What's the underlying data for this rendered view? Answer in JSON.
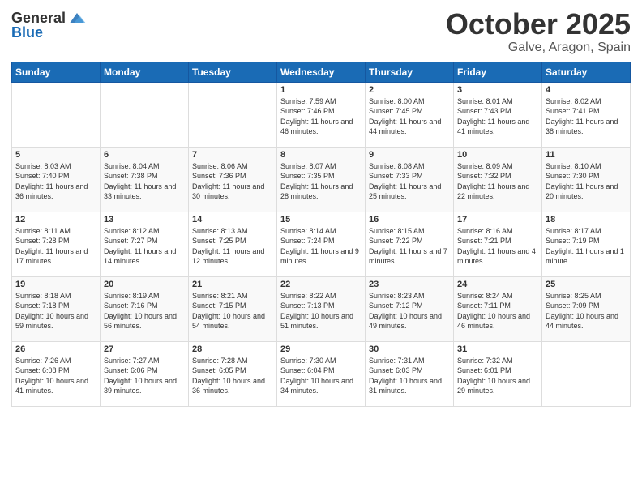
{
  "logo": {
    "general": "General",
    "blue": "Blue"
  },
  "header": {
    "month": "October 2025",
    "location": "Galve, Aragon, Spain"
  },
  "weekdays": [
    "Sunday",
    "Monday",
    "Tuesday",
    "Wednesday",
    "Thursday",
    "Friday",
    "Saturday"
  ],
  "weeks": [
    [
      {
        "day": "",
        "sunrise": "",
        "sunset": "",
        "daylight": ""
      },
      {
        "day": "",
        "sunrise": "",
        "sunset": "",
        "daylight": ""
      },
      {
        "day": "",
        "sunrise": "",
        "sunset": "",
        "daylight": ""
      },
      {
        "day": "1",
        "sunrise": "Sunrise: 7:59 AM",
        "sunset": "Sunset: 7:46 PM",
        "daylight": "Daylight: 11 hours and 46 minutes."
      },
      {
        "day": "2",
        "sunrise": "Sunrise: 8:00 AM",
        "sunset": "Sunset: 7:45 PM",
        "daylight": "Daylight: 11 hours and 44 minutes."
      },
      {
        "day": "3",
        "sunrise": "Sunrise: 8:01 AM",
        "sunset": "Sunset: 7:43 PM",
        "daylight": "Daylight: 11 hours and 41 minutes."
      },
      {
        "day": "4",
        "sunrise": "Sunrise: 8:02 AM",
        "sunset": "Sunset: 7:41 PM",
        "daylight": "Daylight: 11 hours and 38 minutes."
      }
    ],
    [
      {
        "day": "5",
        "sunrise": "Sunrise: 8:03 AM",
        "sunset": "Sunset: 7:40 PM",
        "daylight": "Daylight: 11 hours and 36 minutes."
      },
      {
        "day": "6",
        "sunrise": "Sunrise: 8:04 AM",
        "sunset": "Sunset: 7:38 PM",
        "daylight": "Daylight: 11 hours and 33 minutes."
      },
      {
        "day": "7",
        "sunrise": "Sunrise: 8:06 AM",
        "sunset": "Sunset: 7:36 PM",
        "daylight": "Daylight: 11 hours and 30 minutes."
      },
      {
        "day": "8",
        "sunrise": "Sunrise: 8:07 AM",
        "sunset": "Sunset: 7:35 PM",
        "daylight": "Daylight: 11 hours and 28 minutes."
      },
      {
        "day": "9",
        "sunrise": "Sunrise: 8:08 AM",
        "sunset": "Sunset: 7:33 PM",
        "daylight": "Daylight: 11 hours and 25 minutes."
      },
      {
        "day": "10",
        "sunrise": "Sunrise: 8:09 AM",
        "sunset": "Sunset: 7:32 PM",
        "daylight": "Daylight: 11 hours and 22 minutes."
      },
      {
        "day": "11",
        "sunrise": "Sunrise: 8:10 AM",
        "sunset": "Sunset: 7:30 PM",
        "daylight": "Daylight: 11 hours and 20 minutes."
      }
    ],
    [
      {
        "day": "12",
        "sunrise": "Sunrise: 8:11 AM",
        "sunset": "Sunset: 7:28 PM",
        "daylight": "Daylight: 11 hours and 17 minutes."
      },
      {
        "day": "13",
        "sunrise": "Sunrise: 8:12 AM",
        "sunset": "Sunset: 7:27 PM",
        "daylight": "Daylight: 11 hours and 14 minutes."
      },
      {
        "day": "14",
        "sunrise": "Sunrise: 8:13 AM",
        "sunset": "Sunset: 7:25 PM",
        "daylight": "Daylight: 11 hours and 12 minutes."
      },
      {
        "day": "15",
        "sunrise": "Sunrise: 8:14 AM",
        "sunset": "Sunset: 7:24 PM",
        "daylight": "Daylight: 11 hours and 9 minutes."
      },
      {
        "day": "16",
        "sunrise": "Sunrise: 8:15 AM",
        "sunset": "Sunset: 7:22 PM",
        "daylight": "Daylight: 11 hours and 7 minutes."
      },
      {
        "day": "17",
        "sunrise": "Sunrise: 8:16 AM",
        "sunset": "Sunset: 7:21 PM",
        "daylight": "Daylight: 11 hours and 4 minutes."
      },
      {
        "day": "18",
        "sunrise": "Sunrise: 8:17 AM",
        "sunset": "Sunset: 7:19 PM",
        "daylight": "Daylight: 11 hours and 1 minute."
      }
    ],
    [
      {
        "day": "19",
        "sunrise": "Sunrise: 8:18 AM",
        "sunset": "Sunset: 7:18 PM",
        "daylight": "Daylight: 10 hours and 59 minutes."
      },
      {
        "day": "20",
        "sunrise": "Sunrise: 8:19 AM",
        "sunset": "Sunset: 7:16 PM",
        "daylight": "Daylight: 10 hours and 56 minutes."
      },
      {
        "day": "21",
        "sunrise": "Sunrise: 8:21 AM",
        "sunset": "Sunset: 7:15 PM",
        "daylight": "Daylight: 10 hours and 54 minutes."
      },
      {
        "day": "22",
        "sunrise": "Sunrise: 8:22 AM",
        "sunset": "Sunset: 7:13 PM",
        "daylight": "Daylight: 10 hours and 51 minutes."
      },
      {
        "day": "23",
        "sunrise": "Sunrise: 8:23 AM",
        "sunset": "Sunset: 7:12 PM",
        "daylight": "Daylight: 10 hours and 49 minutes."
      },
      {
        "day": "24",
        "sunrise": "Sunrise: 8:24 AM",
        "sunset": "Sunset: 7:11 PM",
        "daylight": "Daylight: 10 hours and 46 minutes."
      },
      {
        "day": "25",
        "sunrise": "Sunrise: 8:25 AM",
        "sunset": "Sunset: 7:09 PM",
        "daylight": "Daylight: 10 hours and 44 minutes."
      }
    ],
    [
      {
        "day": "26",
        "sunrise": "Sunrise: 7:26 AM",
        "sunset": "Sunset: 6:08 PM",
        "daylight": "Daylight: 10 hours and 41 minutes."
      },
      {
        "day": "27",
        "sunrise": "Sunrise: 7:27 AM",
        "sunset": "Sunset: 6:06 PM",
        "daylight": "Daylight: 10 hours and 39 minutes."
      },
      {
        "day": "28",
        "sunrise": "Sunrise: 7:28 AM",
        "sunset": "Sunset: 6:05 PM",
        "daylight": "Daylight: 10 hours and 36 minutes."
      },
      {
        "day": "29",
        "sunrise": "Sunrise: 7:30 AM",
        "sunset": "Sunset: 6:04 PM",
        "daylight": "Daylight: 10 hours and 34 minutes."
      },
      {
        "day": "30",
        "sunrise": "Sunrise: 7:31 AM",
        "sunset": "Sunset: 6:03 PM",
        "daylight": "Daylight: 10 hours and 31 minutes."
      },
      {
        "day": "31",
        "sunrise": "Sunrise: 7:32 AM",
        "sunset": "Sunset: 6:01 PM",
        "daylight": "Daylight: 10 hours and 29 minutes."
      },
      {
        "day": "",
        "sunrise": "",
        "sunset": "",
        "daylight": ""
      }
    ]
  ]
}
